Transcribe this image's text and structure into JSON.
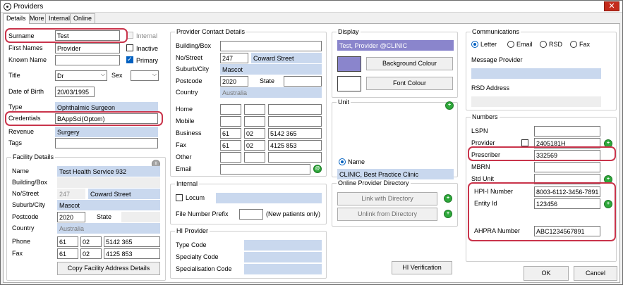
{
  "window": {
    "title": "Providers",
    "close_glyph": "✕"
  },
  "tabs": [
    "Details",
    "More",
    "Internal",
    "Online"
  ],
  "details": {
    "surname_label": "Surname",
    "surname": "Test",
    "internal_label": "Internal",
    "first_names_label": "First Names",
    "first_names": "Provider",
    "inactive_label": "Inactive",
    "known_name_label": "Known Name",
    "known_name": "",
    "primary_label": "Primary",
    "title_label": "Title",
    "title": "Dr",
    "sex_label": "Sex",
    "sex": "",
    "dob_label": "Date of Birth",
    "dob": "20/03/1995",
    "type_label": "Type",
    "type": "Ophthalmic Surgeon",
    "credentials_label": "Credentials",
    "credentials": "BAppSci(Optom)",
    "revenue_label": "Revenue",
    "revenue": "Surgery",
    "tags_label": "Tags",
    "tags": ""
  },
  "facility": {
    "title": "Facility Details",
    "name_label": "Name",
    "name": "Test Health Service 932",
    "building_label": "Building/Box",
    "building": "",
    "street_label": "No/Street",
    "street_no": "247",
    "street": "Coward Street",
    "suburb_label": "Suburb/City",
    "suburb": "Mascot",
    "postcode_label": "Postcode",
    "postcode": "2020",
    "state_label": "State",
    "state": "",
    "country_label": "Country",
    "country": "Australia",
    "phone_label": "Phone",
    "phone_a": "61",
    "phone_b": "02",
    "phone_c": "5142 365",
    "fax_label": "Fax",
    "fax_a": "61",
    "fax_b": "02",
    "fax_c": "4125 853",
    "copy_button": "Copy Facility Address Details"
  },
  "contact": {
    "title": "Provider Contact Details",
    "building_label": "Building/Box",
    "building": "",
    "street_label": "No/Street",
    "street_no": "247",
    "street": "Coward Street",
    "suburb_label": "Suburb/City",
    "suburb": "Mascot",
    "postcode_label": "Postcode",
    "postcode": "2020",
    "state_label": "State",
    "state": "",
    "country_label": "Country",
    "country": "Australia",
    "home_label": "Home",
    "mobile_label": "Mobile",
    "business_label": "Business",
    "business_a": "61",
    "business_b": "02",
    "business_c": "5142 365",
    "fax_label": "Fax",
    "fax_a": "61",
    "fax_b": "02",
    "fax_c": "4125 853",
    "other_label": "Other",
    "email_label": "Email"
  },
  "internal": {
    "title": "Internal",
    "locum_label": "Locum",
    "file_prefix_label": "File Number Prefix",
    "file_prefix_note": "(New patients only)"
  },
  "hi_provider": {
    "title": "HI Provider",
    "type_code_label": "Type Code",
    "specialty_code_label": "Specialty Code",
    "specialisation_code_label": "Specialisation Code",
    "verify_button": "HI Verification"
  },
  "display": {
    "title": "Display",
    "display_name": "Test, Provider @CLINIC",
    "bg_button": "Background Colour",
    "font_button": "Font Colour",
    "bg_color": "#8a85cc",
    "font_color": "#ffffff"
  },
  "unit": {
    "title": "Unit",
    "name_label": "Name",
    "name": "CLINIC, Best Practice Clinic"
  },
  "online_directory": {
    "title": "Online Provider Directory",
    "link_button": "Link with Directory",
    "unlink_button": "Unlink from Directory"
  },
  "communications": {
    "title": "Communications",
    "options": [
      "Letter",
      "Email",
      "RSD",
      "Fax"
    ],
    "selected": "Letter",
    "message_provider_label": "Message Provider",
    "rsd_address_label": "RSD Address"
  },
  "numbers": {
    "title": "Numbers",
    "lspn_label": "LSPN",
    "lspn": "",
    "provider_label": "Provider",
    "provider": "2405181H",
    "prescriber_label": "Prescriber",
    "prescriber": "332569",
    "mbrn_label": "MBRN",
    "mbrn": "",
    "std_unit_label": "Std Unit",
    "std_unit": "",
    "hpii_label": "HPI-I Number",
    "hpii": "8003-6112-3456-7891",
    "entity_label": "Entity Id",
    "entity": "123456",
    "ahpra_label": "AHPRA Number",
    "ahpra": "ABC1234567891"
  },
  "footer": {
    "ok": "OK",
    "cancel": "Cancel"
  },
  "colors": {
    "highlight": "#c9344b",
    "readonly_fill": "#c9d8ee",
    "add_green": "#2ea83a"
  }
}
